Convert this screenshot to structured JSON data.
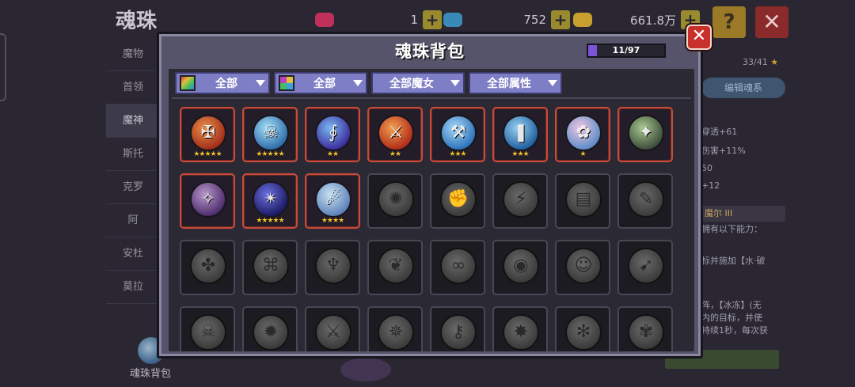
{
  "background": {
    "title": "魂珠",
    "resources": [
      {
        "name": "gem",
        "value": "1",
        "color": "#c0305a"
      },
      {
        "name": "crystal",
        "value": "752",
        "color": "#3a8ab8"
      },
      {
        "name": "gold",
        "value": "661.8万",
        "color": "#c8a030"
      }
    ],
    "plus_label": "+",
    "help_label": "?",
    "close_label": "✕",
    "side_menu": [
      "魔物",
      "首领",
      "魔神",
      "斯托",
      "克罗",
      "阿",
      "安杜",
      "莫拉"
    ],
    "side_menu_active": 2,
    "side_bottom_label": "魂珠背包",
    "right_panel": {
      "count": "33/41",
      "star": "★",
      "edit_button": "编辑魂系",
      "stats": [
        "穿透+61",
        "伤害+11%",
        "50",
        "+12"
      ],
      "skill_name": "魔尔 III",
      "text_lines": [
        "拥有以下能力：",
        "标并施加【水·破",
        "阵，【冰冻】(无",
        "内的目标，并使",
        "持续1秒，每次获"
      ]
    }
  },
  "modal": {
    "title": "魂珠背包",
    "capacity": {
      "text": "11/97",
      "used": 11,
      "total": 97,
      "color": "#7a55d8"
    },
    "close_label": "✕",
    "filters": [
      {
        "label": "全部",
        "icon": "rainbow-square-icon",
        "width": 118
      },
      {
        "label": "全部",
        "icon": "quad-color-square-icon",
        "width": 118
      },
      {
        "label": "全部魔女",
        "icon": "",
        "width": 118
      },
      {
        "label": "全部属性",
        "icon": "",
        "width": 118
      }
    ]
  },
  "slots": [
    {
      "owned": true,
      "stars": 5,
      "icon": "flame-cross-orb-icon",
      "glyph": "✠",
      "colors": [
        "#e8904a",
        "#a02a18"
      ]
    },
    {
      "owned": true,
      "stars": 5,
      "icon": "ice-skeleton-orb-icon",
      "glyph": "☠",
      "colors": [
        "#a8e0f8",
        "#2a6aa8"
      ]
    },
    {
      "owned": true,
      "stars": 2,
      "icon": "water-serpent-orb-icon",
      "glyph": "∮",
      "colors": [
        "#7ab8f0",
        "#3a2a9a"
      ]
    },
    {
      "owned": true,
      "stars": 2,
      "icon": "fire-sword-orb-icon",
      "glyph": "⚔",
      "colors": [
        "#f0a050",
        "#b02818"
      ]
    },
    {
      "owned": true,
      "stars": 3,
      "icon": "ice-hammer-orb-icon",
      "glyph": "⚒",
      "colors": [
        "#a8d8f8",
        "#2a70b8"
      ]
    },
    {
      "owned": true,
      "stars": 3,
      "icon": "ice-crystal-orb-icon",
      "glyph": "❚",
      "colors": [
        "#9ad0f0",
        "#1e5e9e"
      ]
    },
    {
      "owned": true,
      "stars": 1,
      "icon": "lotus-orb-icon",
      "glyph": "✿",
      "colors": [
        "#f0c8e0",
        "#5a8ac8"
      ]
    },
    {
      "owned": true,
      "stars": 0,
      "icon": "nature-rune-orb-icon",
      "glyph": "✦",
      "colors": [
        "#a8c890",
        "#3a4a38"
      ]
    },
    {
      "owned": true,
      "stars": 0,
      "icon": "purple-rune-orb-icon",
      "glyph": "✧",
      "colors": [
        "#b898c8",
        "#4a2a6a"
      ]
    },
    {
      "owned": true,
      "stars": 5,
      "icon": "dark-star-orb-icon",
      "glyph": "✴",
      "colors": [
        "#6a70e0",
        "#1a1860"
      ]
    },
    {
      "owned": true,
      "stars": 4,
      "icon": "gold-compass-orb-icon",
      "glyph": "☄",
      "colors": [
        "#c8e0f0",
        "#5a80b8"
      ]
    },
    {
      "owned": false,
      "icon": "locked-claw-orb-icon",
      "glyph": "✺"
    },
    {
      "owned": false,
      "icon": "locked-fist-orb-icon",
      "glyph": "✊"
    },
    {
      "owned": false,
      "icon": "locked-blade-orb-icon",
      "glyph": "⚡"
    },
    {
      "owned": false,
      "icon": "locked-tablet-orb-icon",
      "glyph": "▤"
    },
    {
      "owned": false,
      "icon": "locked-dagger-orb-icon",
      "glyph": "✎"
    },
    {
      "owned": false,
      "icon": "locked-wing-orb-icon",
      "glyph": "✤"
    },
    {
      "owned": false,
      "icon": "locked-maze-orb-icon",
      "glyph": "⌘"
    },
    {
      "owned": false,
      "icon": "locked-bell-orb-icon",
      "glyph": "♆"
    },
    {
      "owned": false,
      "icon": "locked-cat-orb-icon",
      "glyph": "❦"
    },
    {
      "owned": false,
      "icon": "locked-shackle-orb-icon",
      "glyph": "∞"
    },
    {
      "owned": false,
      "icon": "locked-eye-orb-icon",
      "glyph": "◉"
    },
    {
      "owned": false,
      "icon": "locked-face-orb-icon",
      "glyph": "☺"
    },
    {
      "owned": false,
      "icon": "locked-drill-orb-icon",
      "glyph": "➹"
    },
    {
      "owned": false,
      "icon": "locked-skull-orb-icon",
      "glyph": "☠"
    },
    {
      "owned": false,
      "icon": "locked-beast-orb-icon",
      "glyph": "✹"
    },
    {
      "owned": false,
      "icon": "locked-axe-orb-icon",
      "glyph": "⚔"
    },
    {
      "owned": false,
      "icon": "locked-crab-orb-icon",
      "glyph": "✵"
    },
    {
      "owned": false,
      "icon": "locked-key-orb-icon",
      "glyph": "⚷"
    },
    {
      "owned": false,
      "icon": "locked-dragon-orb-icon",
      "glyph": "✸"
    },
    {
      "owned": false,
      "icon": "locked-bird-orb-icon",
      "glyph": "✻"
    },
    {
      "owned": false,
      "icon": "locked-mask-orb-icon",
      "glyph": "✾"
    }
  ]
}
